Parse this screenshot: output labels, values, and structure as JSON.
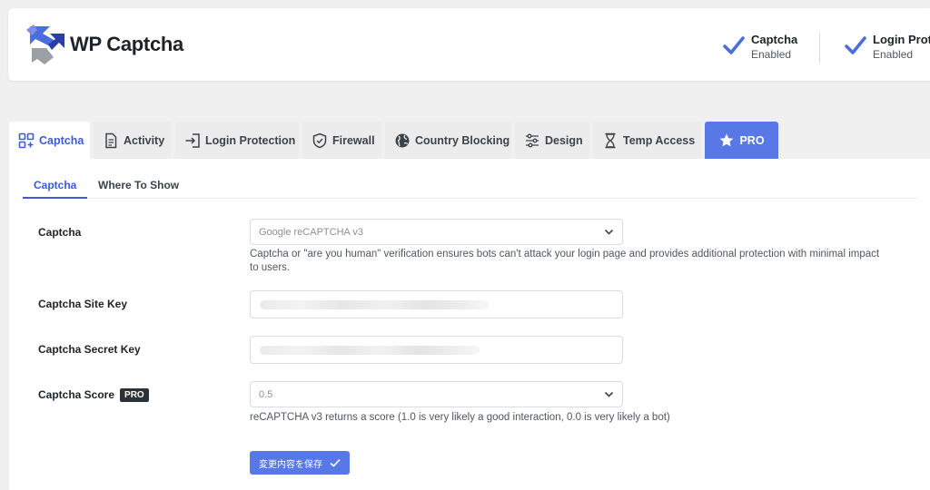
{
  "brand": {
    "name": "WP Captcha",
    "logo_icon": "wp-captcha-logo-icon"
  },
  "status": [
    {
      "title": "Captcha",
      "subtitle": "Enabled",
      "icon": "checkmark-icon"
    },
    {
      "title": "Login Prote",
      "subtitle": "Enabled",
      "icon": "checkmark-icon"
    }
  ],
  "tabs": [
    {
      "label": "Captcha",
      "icon": "captcha-grid-icon",
      "active": true
    },
    {
      "label": "Activity",
      "icon": "document-icon"
    },
    {
      "label": "Login Protection",
      "icon": "login-door-icon"
    },
    {
      "label": "Firewall",
      "icon": "shield-icon"
    },
    {
      "label": "Country Blocking",
      "icon": "globe-icon"
    },
    {
      "label": "Design",
      "icon": "sliders-icon"
    },
    {
      "label": "Temp Access",
      "icon": "hourglass-icon"
    },
    {
      "label": "PRO",
      "icon": "star-icon"
    }
  ],
  "subtabs": [
    {
      "label": "Captcha",
      "active": true
    },
    {
      "label": "Where To Show"
    }
  ],
  "fields": {
    "captcha": {
      "label": "Captcha",
      "value": "Google reCAPTCHA v3",
      "help_line1": "Captcha or \"are you human\" verification ensures bots can't attack your login page and provides additional protection with minimal impact",
      "help_line2": "to users."
    },
    "site_key": {
      "label": "Captcha Site Key"
    },
    "secret_key": {
      "label": "Captcha Secret Key"
    },
    "score": {
      "label": "Captcha Score",
      "badge": "PRO",
      "value": "0.5",
      "help": "reCAPTCHA v3 returns a score (1.0 is very likely a good interaction, 0.0 is very likely a bot)"
    }
  },
  "save_button": {
    "label": "変更内容を保存"
  },
  "colors": {
    "accent": "#5978e8",
    "active_text": "#3b5bdb",
    "check": "#4a6ee0"
  }
}
